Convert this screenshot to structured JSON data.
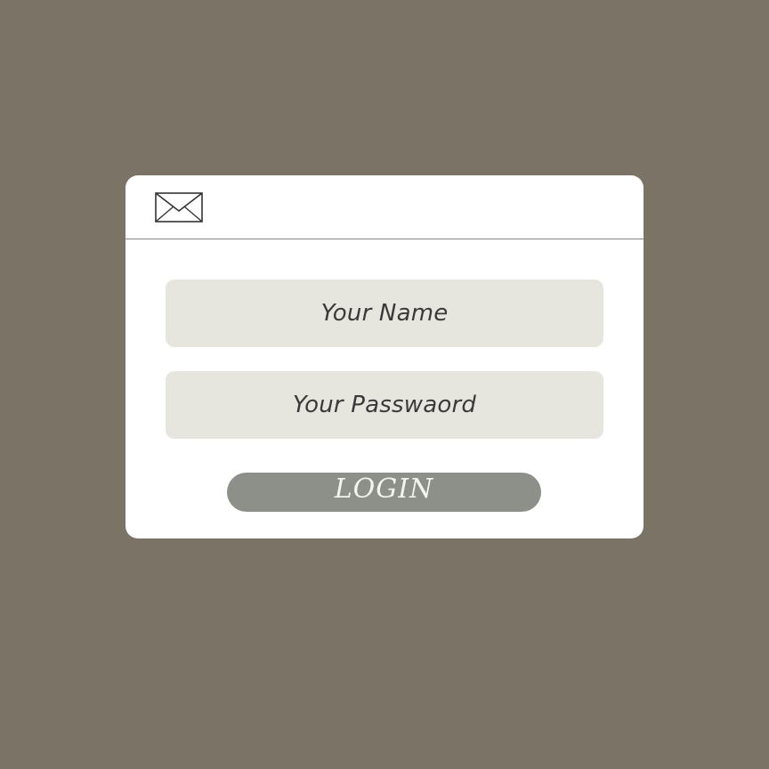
{
  "form": {
    "header_icon": "envelope-icon",
    "name_field": {
      "placeholder": "Your Name"
    },
    "password_field": {
      "placeholder": "Your Passwaord"
    },
    "login_button": {
      "label": "LOGIN"
    }
  },
  "colors": {
    "background": "#7b7366",
    "card": "#ffffff",
    "field": "#e7e6de",
    "button": "#8d9089"
  }
}
